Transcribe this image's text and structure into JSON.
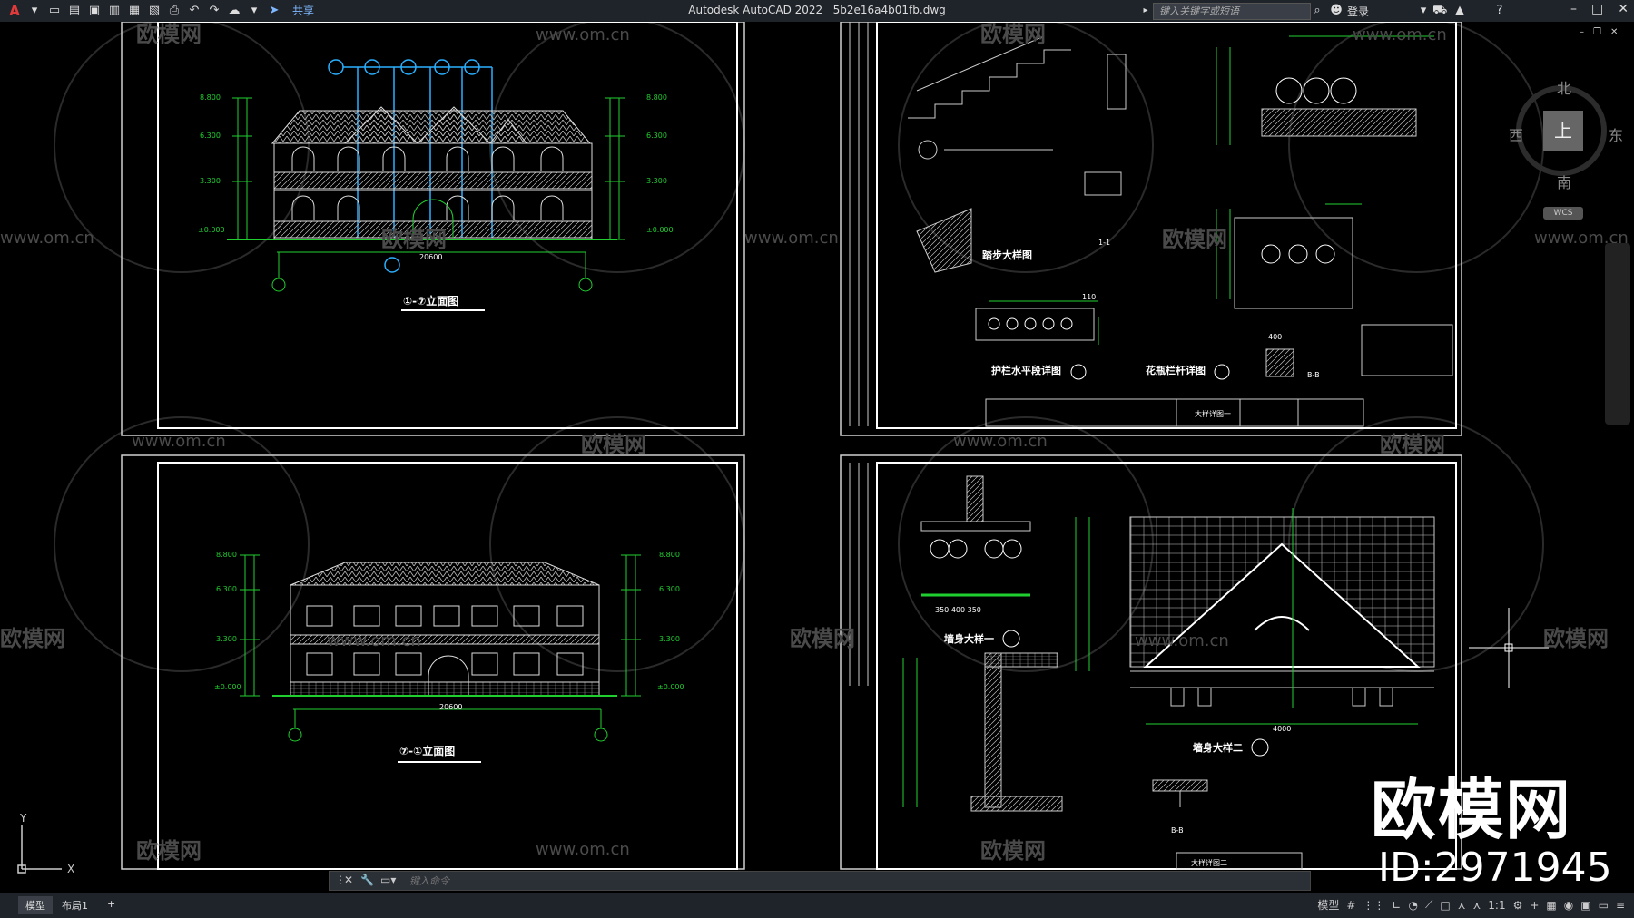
{
  "titlebar": {
    "app_title": "Autodesk AutoCAD 2022",
    "file_name": "5b2e16a4b01fb.dwg",
    "share_label": "共享",
    "search_placeholder": "键入关键字或短语",
    "login_label": "登录"
  },
  "viewcube": {
    "north": "北",
    "south": "南",
    "east": "东",
    "west": "西",
    "top_face": "上",
    "wcs_label": "WCS"
  },
  "sheets": {
    "front_elevation_title": "①-⑦立面图",
    "rear_elevation_title": "⑦-①立面图",
    "front_width_dim": "20600",
    "rear_width_dim": "20600",
    "detail1": {
      "step_detail": "踏步大样图",
      "railing_elev": "护栏水平段详图",
      "vase_railing": "花瓶栏杆详图",
      "sheet_name": "大样详图一",
      "dim_110": "110",
      "dim_400": "400",
      "section_b": "B-B",
      "section_1": "1-1"
    },
    "detail2": {
      "wall_detail1": "墙身大样一",
      "wall_detail2": "墙身大样二",
      "sheet_name": "大样详图二",
      "dim_4000": "4000",
      "dim_350": "350 400 350",
      "section_b": "B-B"
    },
    "elev_levels_left": [
      "8.800",
      "6.300",
      "3.300",
      "±0.000"
    ],
    "elev_levels_right": [
      "8.800",
      "6.300",
      "3.300",
      "±0.000"
    ]
  },
  "watermark": {
    "site": "www.om.cn",
    "brand": "欧模网",
    "brand_big": "欧模网",
    "id_text": "ID:2971945"
  },
  "commandline": {
    "placeholder": "键入命令"
  },
  "statusbar": {
    "tabs": [
      "模型",
      "布局1"
    ],
    "add_tab": "+",
    "model_label": "模型",
    "scale": "1:1"
  },
  "colors": {
    "green": "#1fcf2f",
    "cyan": "#2ab0ff",
    "white": "#ffffff",
    "frame": "#cfcfcf"
  }
}
